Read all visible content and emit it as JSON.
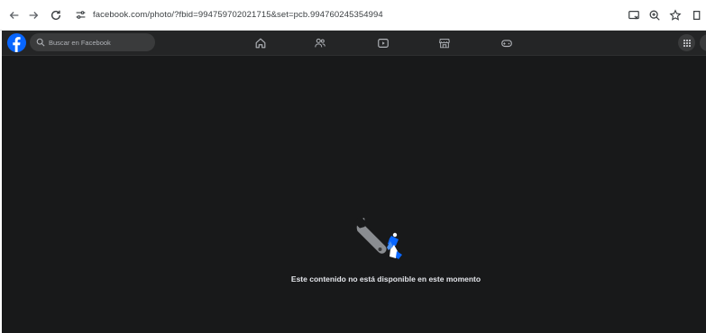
{
  "browser": {
    "url": "facebook.com/photo/?fbid=994759702021715&set=pcb.994760245354994",
    "icons": {
      "back": "arrow-left-icon",
      "forward": "arrow-right-icon",
      "reload": "reload-icon",
      "site_info": "tune-icon",
      "cast": "cast-icon",
      "zoom": "zoom-icon",
      "bookmark": "star-icon",
      "extension": "sidepanel-icon"
    }
  },
  "facebook": {
    "search": {
      "placeholder": "Buscar en Facebook"
    },
    "nav_icons": [
      "home-icon",
      "friends-icon",
      "video-icon",
      "marketplace-icon",
      "gaming-icon"
    ],
    "message": "Este contenido no está disponible en este momento",
    "colors": {
      "brand": "#0866ff",
      "background": "#18191a",
      "topbar": "#242526",
      "text": "#e4e6eb"
    }
  }
}
